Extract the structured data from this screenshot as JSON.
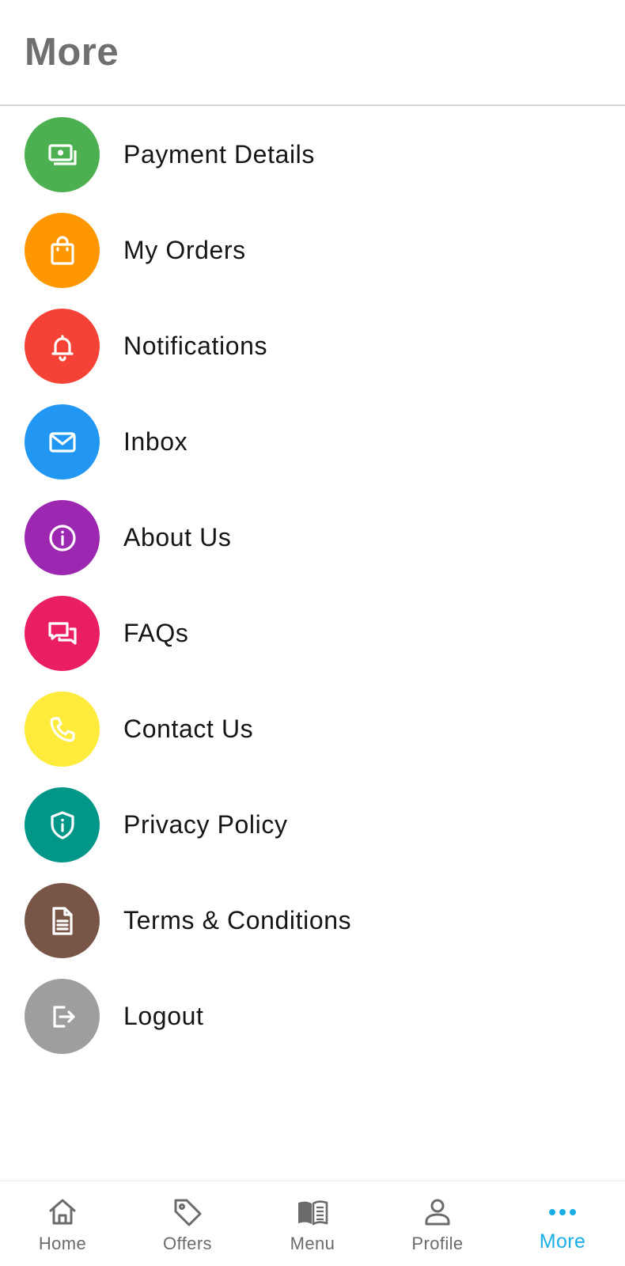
{
  "header": {
    "title": "More"
  },
  "menu": {
    "items": [
      {
        "label": "Payment Details",
        "icon": "money-icon",
        "color": "#4caf50"
      },
      {
        "label": "My Orders",
        "icon": "shopping-bag-icon",
        "color": "#ff9800"
      },
      {
        "label": "Notifications",
        "icon": "bell-icon",
        "color": "#f44336"
      },
      {
        "label": "Inbox",
        "icon": "envelope-icon",
        "color": "#2196f3"
      },
      {
        "label": "About Us",
        "icon": "info-icon",
        "color": "#9c27b0"
      },
      {
        "label": "FAQs",
        "icon": "chat-icon",
        "color": "#e91e63"
      },
      {
        "label": "Contact Us",
        "icon": "phone-icon",
        "color": "#ffeb3b"
      },
      {
        "label": "Privacy Policy",
        "icon": "shield-icon",
        "color": "#009688"
      },
      {
        "label": "Terms & Conditions",
        "icon": "document-icon",
        "color": "#795548"
      },
      {
        "label": "Logout",
        "icon": "logout-icon",
        "color": "#9e9e9e"
      }
    ]
  },
  "bottom_nav": {
    "items": [
      {
        "label": "Home",
        "icon": "home-icon",
        "active": false
      },
      {
        "label": "Offers",
        "icon": "tag-icon",
        "active": false
      },
      {
        "label": "Menu",
        "icon": "book-icon",
        "active": false
      },
      {
        "label": "Profile",
        "icon": "person-icon",
        "active": false
      },
      {
        "label": "More",
        "icon": "more-dots-icon",
        "active": true
      }
    ],
    "active_color": "#1aaee6",
    "inactive_color": "#6b6b6b"
  }
}
